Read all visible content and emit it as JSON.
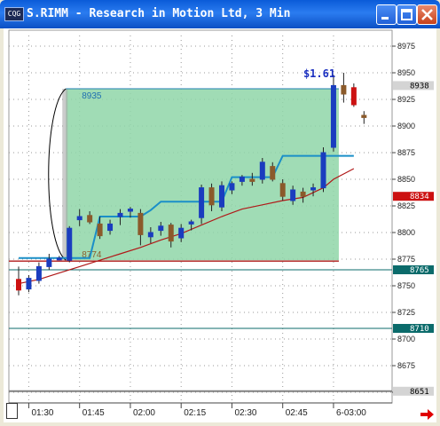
{
  "window": {
    "title": "S.RIMM - Research in Motion Ltd, 3 Min",
    "icon_text": "CQG"
  },
  "y_axis": {
    "labels": [
      "8975",
      "8950",
      "8925",
      "8900",
      "8875",
      "8850",
      "8825",
      "8800",
      "8775",
      "8750",
      "8725",
      "8700",
      "8675",
      "8650"
    ],
    "tags": [
      {
        "text": "8938",
        "bg": "#d4d4d4",
        "fg": "#000000"
      },
      {
        "text": "8834",
        "bg": "#cc1111",
        "fg": "#ffffff"
      },
      {
        "text": "8765",
        "bg": "#0b6b6b",
        "fg": "#ffffff"
      },
      {
        "text": "8710",
        "bg": "#0b6b6b",
        "fg": "#ffffff"
      },
      {
        "text": "8651",
        "bg": "#d4d4d4",
        "fg": "#000000"
      }
    ]
  },
  "x_axis": {
    "labels": [
      "01:30",
      "01:45",
      "02:00",
      "02:15",
      "02:30",
      "02:45",
      "6-03:00"
    ]
  },
  "annotations": {
    "box_high": "8935",
    "box_low": "8774",
    "gain": "$1.61"
  },
  "chart_data": {
    "type": "candlestick",
    "symbol": "S.RIMM",
    "interval_minutes": 3,
    "y_range": [
      8640,
      8985
    ],
    "x": [
      "01:27",
      "01:30",
      "01:33",
      "01:36",
      "01:39",
      "01:42",
      "01:45",
      "01:48",
      "01:51",
      "01:54",
      "01:57",
      "02:00",
      "02:03",
      "02:06",
      "02:09",
      "02:12",
      "02:15",
      "02:18",
      "02:21",
      "02:24",
      "02:27",
      "02:30",
      "02:33",
      "02:36",
      "02:39",
      "02:42",
      "02:45",
      "02:48",
      "02:51",
      "02:54",
      "02:57",
      "03:00",
      "03:03"
    ],
    "candles": [
      {
        "o": 8756,
        "h": 8768,
        "l": 8741,
        "c": 8746
      },
      {
        "o": 8747,
        "h": 8760,
        "l": 8744,
        "c": 8757
      },
      {
        "o": 8755,
        "h": 8772,
        "l": 8752,
        "c": 8768
      },
      {
        "o": 8768,
        "h": 8780,
        "l": 8765,
        "c": 8775
      },
      {
        "o": 8776,
        "h": 8778,
        "l": 8774,
        "c": 8776
      },
      {
        "o": 8774,
        "h": 8806,
        "l": 8772,
        "c": 8804
      },
      {
        "o": 8812,
        "h": 8822,
        "l": 8806,
        "c": 8815
      },
      {
        "o": 8816,
        "h": 8820,
        "l": 8808,
        "c": 8810
      },
      {
        "o": 8808,
        "h": 8815,
        "l": 8794,
        "c": 8797
      },
      {
        "o": 8802,
        "h": 8812,
        "l": 8798,
        "c": 8808
      },
      {
        "o": 8815,
        "h": 8822,
        "l": 8807,
        "c": 8818
      },
      {
        "o": 8820,
        "h": 8824,
        "l": 8814,
        "c": 8822
      },
      {
        "o": 8818,
        "h": 8822,
        "l": 8788,
        "c": 8798
      },
      {
        "o": 8796,
        "h": 8805,
        "l": 8790,
        "c": 8800
      },
      {
        "o": 8802,
        "h": 8810,
        "l": 8797,
        "c": 8806
      },
      {
        "o": 8807,
        "h": 8809,
        "l": 8786,
        "c": 8792
      },
      {
        "o": 8795,
        "h": 8808,
        "l": 8791,
        "c": 8804
      },
      {
        "o": 8808,
        "h": 8812,
        "l": 8802,
        "c": 8810
      },
      {
        "o": 8814,
        "h": 8845,
        "l": 8808,
        "c": 8842
      },
      {
        "o": 8842,
        "h": 8846,
        "l": 8820,
        "c": 8826
      },
      {
        "o": 8824,
        "h": 8848,
        "l": 8820,
        "c": 8844
      },
      {
        "o": 8840,
        "h": 8848,
        "l": 8836,
        "c": 8846
      },
      {
        "o": 8848,
        "h": 8854,
        "l": 8844,
        "c": 8852
      },
      {
        "o": 8850,
        "h": 8856,
        "l": 8844,
        "c": 8848
      },
      {
        "o": 8850,
        "h": 8870,
        "l": 8846,
        "c": 8866
      },
      {
        "o": 8862,
        "h": 8866,
        "l": 8848,
        "c": 8850
      },
      {
        "o": 8846,
        "h": 8850,
        "l": 8830,
        "c": 8834
      },
      {
        "o": 8830,
        "h": 8844,
        "l": 8826,
        "c": 8840
      },
      {
        "o": 8838,
        "h": 8842,
        "l": 8828,
        "c": 8834
      },
      {
        "o": 8840,
        "h": 8846,
        "l": 8834,
        "c": 8842
      },
      {
        "o": 8842,
        "h": 8880,
        "l": 8838,
        "c": 8875
      },
      {
        "o": 8880,
        "h": 8948,
        "l": 8876,
        "c": 8938
      },
      {
        "o": 8938,
        "h": 8950,
        "l": 8922,
        "c": 8930
      },
      {
        "o": 8936,
        "h": 8940,
        "l": 8918,
        "c": 8920
      },
      {
        "o": 8910,
        "h": 8914,
        "l": 8902,
        "c": 8908
      }
    ],
    "step_line": [
      [
        0,
        8776
      ],
      [
        5,
        8776
      ],
      [
        6,
        8776
      ],
      [
        7,
        8776
      ],
      [
        8,
        8815
      ],
      [
        9,
        8815
      ],
      [
        10,
        8815
      ],
      [
        11,
        8815
      ],
      [
        12,
        8815
      ],
      [
        13,
        8821
      ],
      [
        14,
        8829
      ],
      [
        15,
        8829
      ],
      [
        16,
        8829
      ],
      [
        17,
        8829
      ],
      [
        18,
        8829
      ],
      [
        19,
        8829
      ],
      [
        20,
        8829
      ],
      [
        21,
        8852
      ],
      [
        22,
        8852
      ],
      [
        23,
        8852
      ],
      [
        24,
        8852
      ],
      [
        25,
        8852
      ],
      [
        26,
        8872
      ],
      [
        27,
        8872
      ],
      [
        28,
        8872
      ],
      [
        29,
        8872
      ],
      [
        30,
        8872
      ],
      [
        31,
        8872
      ],
      [
        32,
        8872
      ],
      [
        33,
        8872
      ]
    ],
    "moving_average": [
      [
        0,
        8752
      ],
      [
        2,
        8756
      ],
      [
        4,
        8762
      ],
      [
        6,
        8768
      ],
      [
        8,
        8774
      ],
      [
        10,
        8780
      ],
      [
        12,
        8786
      ],
      [
        14,
        8793
      ],
      [
        16,
        8799
      ],
      [
        18,
        8807
      ],
      [
        20,
        8815
      ],
      [
        22,
        8822
      ],
      [
        24,
        8826
      ],
      [
        26,
        8830
      ],
      [
        28,
        8833
      ],
      [
        30,
        8842
      ],
      [
        31,
        8850
      ],
      [
        32,
        8855
      ],
      [
        33,
        8860
      ]
    ],
    "shaded_box": {
      "x_start": 5,
      "x_end": 31,
      "high": 8935,
      "low": 8774
    },
    "horizontal_lines": [
      {
        "y": 8765,
        "color": "#0b6b6b"
      },
      {
        "y": 8710,
        "color": "#0b6b6b"
      },
      {
        "y": 8651,
        "color": "#808080"
      }
    ]
  }
}
